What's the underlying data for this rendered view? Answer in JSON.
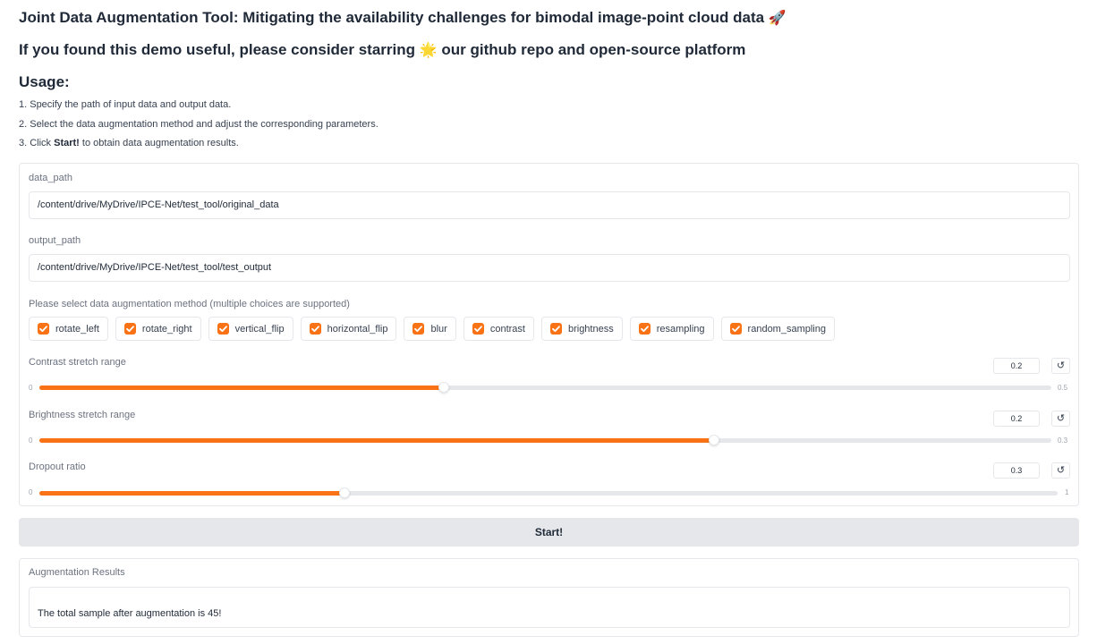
{
  "header": {
    "title": "Joint Data Augmentation Tool: Mitigating the availability challenges for bimodal image-point cloud data",
    "title_emoji": "🚀",
    "subtitle_before": "If you found this demo useful, please consider starring",
    "subtitle_emoji": "🌟",
    "subtitle_after": "our github repo and open-source platform",
    "usage_heading": "Usage:",
    "usage_steps": {
      "s1": "1. Specify the path of input data and output data.",
      "s2": "2. Select the data augmentation method and adjust the corresponding parameters.",
      "s3_prefix": "3. Click",
      "s3_bold": "Start!",
      "s3_suffix": "to obtain data augmentation results."
    }
  },
  "form": {
    "data_path": {
      "label": "data_path",
      "value": "/content/drive/MyDrive/IPCE-Net/test_tool/original_data"
    },
    "output_path": {
      "label": "output_path",
      "value": "/content/drive/MyDrive/IPCE-Net/test_tool/test_output"
    },
    "methods": {
      "label": "Please select data augmentation method (multiple choices are supported)",
      "options": [
        {
          "label": "rotate_left",
          "checked": true
        },
        {
          "label": "rotate_right",
          "checked": true
        },
        {
          "label": "vertical_flip",
          "checked": true
        },
        {
          "label": "horizontal_flip",
          "checked": true
        },
        {
          "label": "blur",
          "checked": true
        },
        {
          "label": "contrast",
          "checked": true
        },
        {
          "label": "brightness",
          "checked": true
        },
        {
          "label": "resampling",
          "checked": true
        },
        {
          "label": "random_sampling",
          "checked": true
        }
      ]
    },
    "sliders": {
      "contrast": {
        "label": "Contrast stretch range",
        "value": "0.2",
        "min": "0",
        "max": "0.5",
        "fraction": 0.4
      },
      "brightness": {
        "label": "Brightness stretch range",
        "value": "0.2",
        "min": "0",
        "max": "0.3",
        "fraction": 0.6667
      },
      "dropout": {
        "label": "Dropout ratio",
        "value": "0.3",
        "min": "0",
        "max": "1",
        "fraction": 0.3
      }
    },
    "reset_icon": "↺"
  },
  "start_button": {
    "label": "Start!"
  },
  "results": {
    "label": "Augmentation Results",
    "text": "The total sample after augmentation is 45!"
  },
  "colors": {
    "accent": "#f97316",
    "button_bg": "#e5e7eb",
    "border": "#e5e7eb"
  }
}
